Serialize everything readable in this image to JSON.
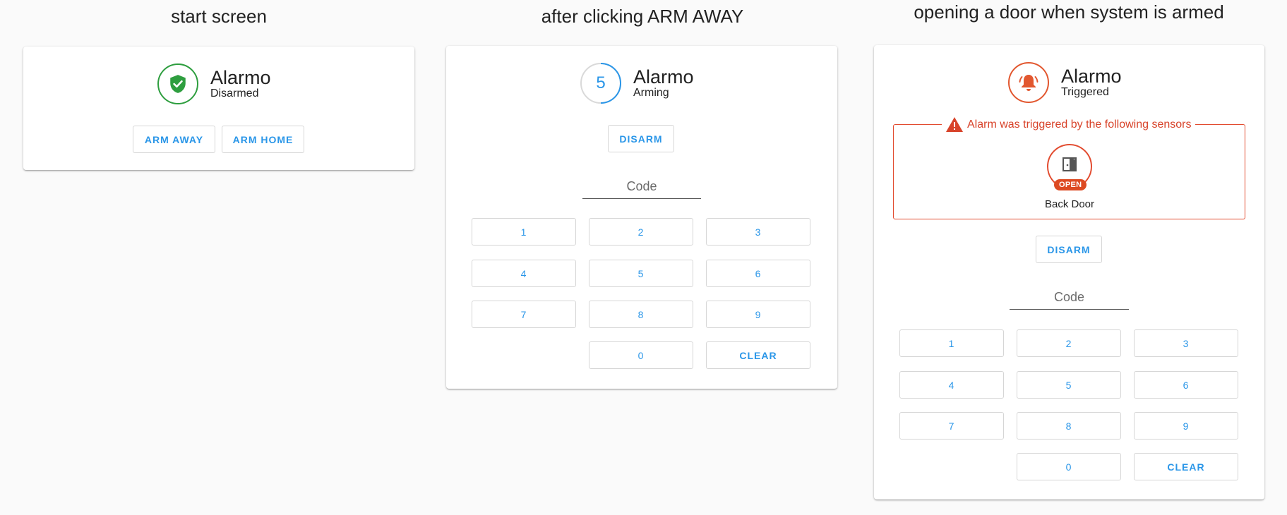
{
  "captions": [
    "start screen",
    "after clicking ARM AWAY",
    "opening a door when system is armed"
  ],
  "colors": {
    "accent": "#2a96e8",
    "disarmed": "#2e9e3f",
    "triggered": "#e2572f"
  },
  "panel1": {
    "title": "Alarmo",
    "state": "Disarmed",
    "icon": "shield-check-icon",
    "buttons": [
      "ARM AWAY",
      "ARM HOME"
    ]
  },
  "panel2": {
    "title": "Alarmo",
    "state": "Arming",
    "countdown": "5",
    "disarm_label": "DISARM",
    "code_placeholder": "Code",
    "keys": [
      "1",
      "2",
      "3",
      "4",
      "5",
      "6",
      "7",
      "8",
      "9",
      "0",
      "CLEAR"
    ]
  },
  "panel3": {
    "title": "Alarmo",
    "state": "Triggered",
    "icon": "bell-ring-icon",
    "alert_text": "Alarm was triggered by the following sensors",
    "sensor": {
      "name": "Back Door",
      "badge": "OPEN",
      "icon": "door-open-icon"
    },
    "disarm_label": "DISARM",
    "code_placeholder": "Code",
    "keys": [
      "1",
      "2",
      "3",
      "4",
      "5",
      "6",
      "7",
      "8",
      "9",
      "0",
      "CLEAR"
    ]
  }
}
